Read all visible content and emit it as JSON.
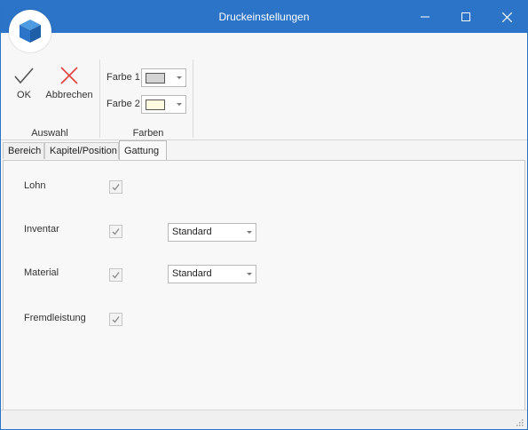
{
  "window": {
    "title": "Druckeinstellungen"
  },
  "ribbon": {
    "auswahl": {
      "ok_label": "OK",
      "cancel_label": "Abbrechen",
      "group_label": "Auswahl"
    },
    "farben": {
      "group_label": "Farben",
      "farbe1_label": "Farbe 1",
      "farbe1_color": "#d4d4d4",
      "farbe2_label": "Farbe 2",
      "farbe2_color": "#fffbe0"
    }
  },
  "tabs": [
    {
      "label": "Bereich",
      "active": false
    },
    {
      "label": "Kapitel/Position",
      "active": false
    },
    {
      "label": "Gattung",
      "active": true
    }
  ],
  "gattung": {
    "rows": [
      {
        "label": "Lohn",
        "checked": true
      },
      {
        "label": "Inventar",
        "checked": true,
        "select_value": "Standard"
      },
      {
        "label": "Material",
        "checked": true,
        "select_value": "Standard"
      },
      {
        "label": "Fremdleistung",
        "checked": true
      }
    ]
  },
  "colors": {
    "titlebar": "#2b74c7",
    "ok_check": "#555555",
    "cancel_x": "#e04040"
  }
}
